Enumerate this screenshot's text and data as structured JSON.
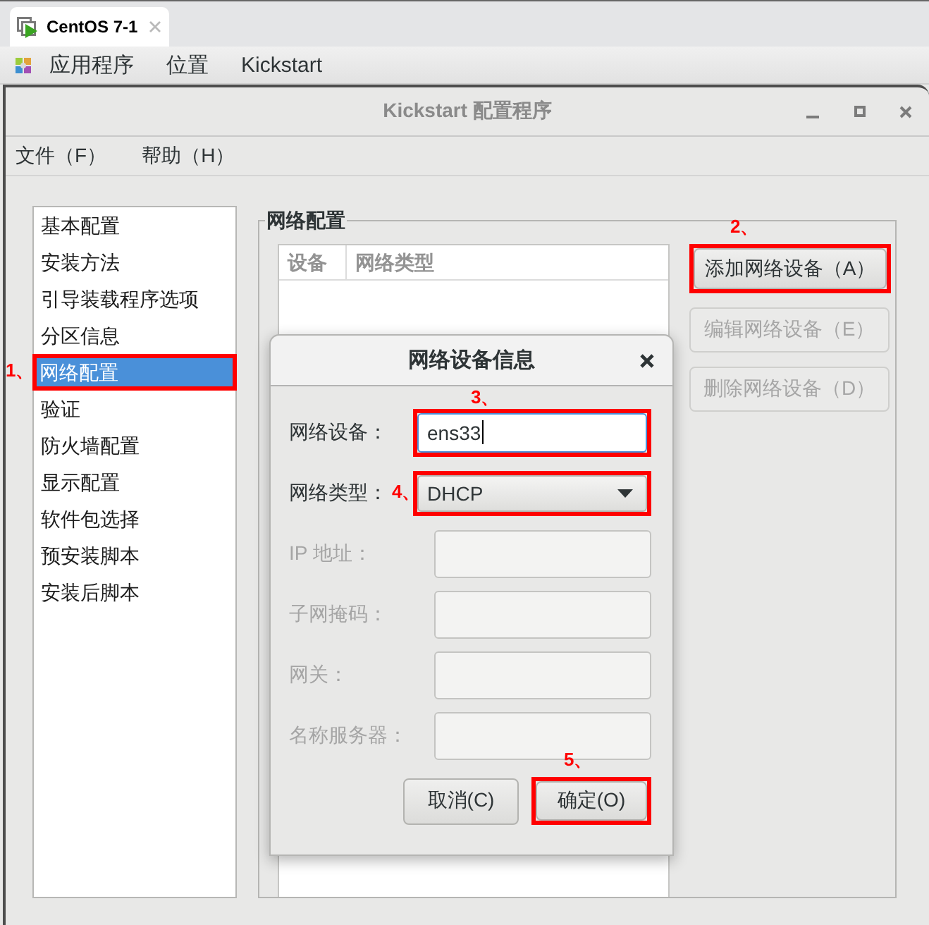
{
  "vm_tabs": [
    {
      "label": "CentOS 7-1",
      "selected": true
    }
  ],
  "top_bar": {
    "menus": [
      "应用程序",
      "位置",
      "Kickstart"
    ]
  },
  "window": {
    "title": "Kickstart 配置程序",
    "menus": [
      "文件（F）",
      "帮助（H）"
    ]
  },
  "sidebar": {
    "items": [
      {
        "label": "基本配置",
        "selected": false
      },
      {
        "label": "安装方法",
        "selected": false
      },
      {
        "label": "引导装载程序选项",
        "selected": false
      },
      {
        "label": "分区信息",
        "selected": false
      },
      {
        "label": "网络配置",
        "selected": true,
        "callout": "1、"
      },
      {
        "label": "验证",
        "selected": false
      },
      {
        "label": "防火墙配置",
        "selected": false
      },
      {
        "label": "显示配置",
        "selected": false
      },
      {
        "label": "软件包选择",
        "selected": false
      },
      {
        "label": "预安装脚本",
        "selected": false
      },
      {
        "label": "安装后脚本",
        "selected": false
      }
    ]
  },
  "network_panel": {
    "title": "网络配置",
    "table": {
      "columns": [
        "设备",
        "网络类型"
      ]
    },
    "buttons": [
      {
        "label": "添加网络设备（A）",
        "disabled": false,
        "callout": "2、"
      },
      {
        "label": "编辑网络设备（E）",
        "disabled": true
      },
      {
        "label": "删除网络设备（D）",
        "disabled": true
      }
    ]
  },
  "dialog": {
    "title": "网络设备信息",
    "fields": [
      {
        "kind": "text",
        "label": "网络设备：",
        "value": "ens33",
        "disabled": false,
        "focused": true,
        "callout": "3、"
      },
      {
        "kind": "select",
        "label": "网络类型：",
        "value": "DHCP",
        "disabled": false,
        "focused": false,
        "callout": "4、"
      },
      {
        "kind": "text",
        "label": "IP 地址：",
        "disabled": true,
        "focused": false
      },
      {
        "kind": "text",
        "label": "子网掩码：",
        "disabled": true,
        "focused": false
      },
      {
        "kind": "text",
        "label": "网关：",
        "disabled": true,
        "focused": false
      },
      {
        "kind": "text",
        "label": "名称服务器：",
        "disabled": true,
        "focused": false
      }
    ],
    "buttons": [
      {
        "label": "取消(C)"
      },
      {
        "label": "确定(O)",
        "callout": "5、"
      }
    ]
  }
}
